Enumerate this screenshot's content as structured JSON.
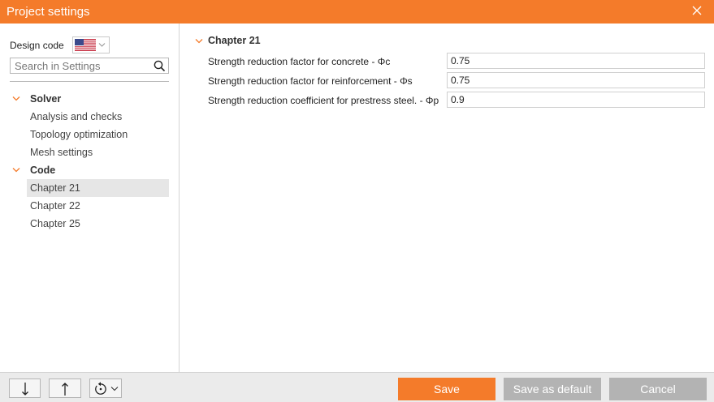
{
  "window": {
    "title": "Project settings"
  },
  "sidebar": {
    "design_code_label": "Design code",
    "design_code_flag": "us-flag-icon",
    "search": {
      "placeholder": "Search in Settings",
      "value": ""
    },
    "groups": [
      {
        "label": "Solver",
        "items": [
          {
            "label": "Analysis and checks",
            "selected": false
          },
          {
            "label": "Topology optimization",
            "selected": false
          },
          {
            "label": "Mesh settings",
            "selected": false
          }
        ]
      },
      {
        "label": "Code",
        "items": [
          {
            "label": "Chapter 21",
            "selected": true
          },
          {
            "label": "Chapter 22",
            "selected": false
          },
          {
            "label": "Chapter 25",
            "selected": false
          }
        ]
      }
    ]
  },
  "content": {
    "section_title": "Chapter 21",
    "properties": [
      {
        "label": "Strength reduction factor for concrete - Φc",
        "value": "0.75"
      },
      {
        "label": "Strength reduction factor for reinforcement - Φs",
        "value": "0.75"
      },
      {
        "label": "Strength reduction coefficient for prestress steel. - Φp",
        "value": "0.9"
      }
    ]
  },
  "footer": {
    "icons": [
      "arrow-down-icon",
      "arrow-up-icon",
      "reset-icon"
    ],
    "save_label": "Save",
    "save_default_label": "Save as default",
    "cancel_label": "Cancel"
  },
  "colors": {
    "accent": "#f47b2a",
    "disabled_button": "#b3b3b3",
    "selected_row": "#e6e6e6"
  }
}
